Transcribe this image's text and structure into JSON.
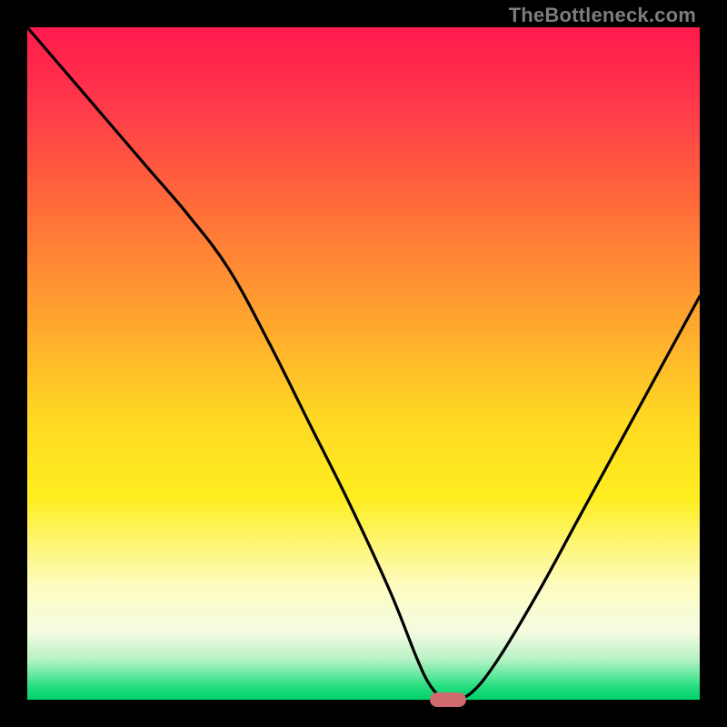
{
  "watermark": "TheBottleneck.com",
  "colors": {
    "frame": "#000000",
    "gradient_top": "#ff1a4d",
    "gradient_bottom": "#00d26a",
    "curve": "#000000",
    "marker": "#cf6b6f",
    "watermark": "#7d7d7d"
  },
  "chart_data": {
    "type": "line",
    "title": "",
    "xlabel": "",
    "ylabel": "",
    "xlim": [
      0,
      100
    ],
    "ylim": [
      0,
      100
    ],
    "grid": false,
    "legend": false,
    "series": [
      {
        "name": "bottleneck-curve",
        "x": [
          0,
          6,
          12,
          18,
          24,
          30,
          36,
          42,
          48,
          54,
          58,
          60,
          62,
          63,
          66,
          70,
          76,
          82,
          88,
          94,
          100
        ],
        "values": [
          100,
          93,
          86,
          79,
          72,
          64,
          53,
          41,
          29,
          16,
          6,
          2,
          0,
          0,
          1,
          6,
          16,
          27,
          38,
          49,
          60
        ]
      }
    ],
    "marker": {
      "x": 62.5,
      "y": 0
    }
  }
}
